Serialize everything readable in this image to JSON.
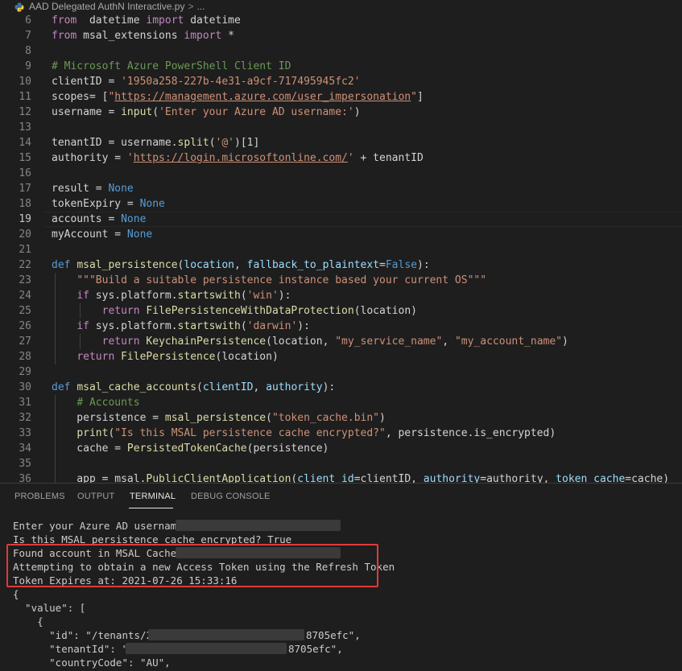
{
  "breadcrumb": {
    "file": "AAD Delegated AuthN Interactive.py",
    "separator": ">",
    "more": "..."
  },
  "editor": {
    "active_line": "19",
    "lines": [
      {
        "n": "6",
        "parts": [
          [
            "kw2",
            "from"
          ],
          [
            "",
            "  datetime "
          ],
          [
            "kw2",
            "import"
          ],
          [
            "",
            " datetime"
          ]
        ]
      },
      {
        "n": "7",
        "parts": [
          [
            "kw2",
            "from"
          ],
          [
            "",
            " msal_extensions "
          ],
          [
            "kw2",
            "import"
          ],
          [
            "",
            " *"
          ]
        ]
      },
      {
        "n": "8",
        "parts": []
      },
      {
        "n": "9",
        "parts": [
          [
            "cm",
            "# Microsoft Azure PowerShell Client ID"
          ]
        ]
      },
      {
        "n": "10",
        "parts": [
          [
            "",
            "clientID = "
          ],
          [
            "str",
            "'1950a258-227b-4e31-a9cf-717495945fc2'"
          ]
        ]
      },
      {
        "n": "11",
        "parts": [
          [
            "",
            "scopes= ["
          ],
          [
            "str",
            "\""
          ],
          [
            "str link",
            "https://management.azure.com/user_impersonation"
          ],
          [
            "str",
            "\""
          ],
          [
            "",
            "]"
          ]
        ]
      },
      {
        "n": "12",
        "parts": [
          [
            "",
            "username = "
          ],
          [
            "fn",
            "input"
          ],
          [
            "",
            "("
          ],
          [
            "str",
            "'Enter your Azure AD username:'"
          ],
          [
            "",
            ")"
          ]
        ]
      },
      {
        "n": "13",
        "parts": []
      },
      {
        "n": "14",
        "parts": [
          [
            "",
            "tenantID = username."
          ],
          [
            "fn",
            "split"
          ],
          [
            "",
            "("
          ],
          [
            "str",
            "'@'"
          ],
          [
            "",
            ")[1]"
          ]
        ]
      },
      {
        "n": "15",
        "parts": [
          [
            "",
            "authority = "
          ],
          [
            "str",
            "'"
          ],
          [
            "str link",
            "https://login.microsoftonline.com/"
          ],
          [
            "str",
            "'"
          ],
          [
            "",
            " + tenantID"
          ]
        ]
      },
      {
        "n": "16",
        "parts": []
      },
      {
        "n": "17",
        "parts": [
          [
            "",
            "result = "
          ],
          [
            "kw",
            "None"
          ]
        ]
      },
      {
        "n": "18",
        "parts": [
          [
            "",
            "tokenExpiry = "
          ],
          [
            "kw",
            "None"
          ]
        ]
      },
      {
        "n": "19",
        "parts": [
          [
            "",
            "accounts = "
          ],
          [
            "kw",
            "None"
          ]
        ]
      },
      {
        "n": "20",
        "parts": [
          [
            "",
            "myAccount = "
          ],
          [
            "kw",
            "None"
          ]
        ]
      },
      {
        "n": "21",
        "parts": []
      },
      {
        "n": "22",
        "parts": [
          [
            "kw",
            "def"
          ],
          [
            " ",
            ""
          ],
          [
            "fn",
            "msal_persistence"
          ],
          [
            "",
            "("
          ],
          [
            "pm",
            "location"
          ],
          [
            "",
            ", "
          ],
          [
            "pm",
            "fallback_to_plaintext"
          ],
          [
            "",
            "="
          ],
          [
            "kw",
            "False"
          ],
          [
            "",
            "):"
          ]
        ]
      },
      {
        "n": "23",
        "parts": [
          [
            "",
            "    "
          ],
          [
            "str",
            "\"\"\"Build a suitable persistence instance based your current OS\"\"\""
          ]
        ]
      },
      {
        "n": "24",
        "parts": [
          [
            "",
            "    "
          ],
          [
            "kw2",
            "if"
          ],
          [
            "",
            " sys.platform."
          ],
          [
            "fn",
            "startswith"
          ],
          [
            "",
            "("
          ],
          [
            "str",
            "'win'"
          ],
          [
            "",
            "):"
          ]
        ]
      },
      {
        "n": "25",
        "parts": [
          [
            "",
            "        "
          ],
          [
            "kw2",
            "return"
          ],
          [
            "",
            " "
          ],
          [
            "fn",
            "FilePersistenceWithDataProtection"
          ],
          [
            "",
            "(location)"
          ]
        ]
      },
      {
        "n": "26",
        "parts": [
          [
            "",
            "    "
          ],
          [
            "kw2",
            "if"
          ],
          [
            "",
            " sys.platform."
          ],
          [
            "fn",
            "startswith"
          ],
          [
            "",
            "("
          ],
          [
            "str",
            "'darwin'"
          ],
          [
            "",
            "):"
          ]
        ]
      },
      {
        "n": "27",
        "parts": [
          [
            "",
            "        "
          ],
          [
            "kw2",
            "return"
          ],
          [
            "",
            " "
          ],
          [
            "fn",
            "KeychainPersistence"
          ],
          [
            "",
            "(location, "
          ],
          [
            "str",
            "\"my_service_name\""
          ],
          [
            "",
            ", "
          ],
          [
            "str",
            "\"my_account_name\""
          ],
          [
            "",
            ")"
          ]
        ]
      },
      {
        "n": "28",
        "parts": [
          [
            "",
            "    "
          ],
          [
            "kw2",
            "return"
          ],
          [
            "",
            " "
          ],
          [
            "fn",
            "FilePersistence"
          ],
          [
            "",
            "(location)"
          ]
        ]
      },
      {
        "n": "29",
        "parts": []
      },
      {
        "n": "30",
        "parts": [
          [
            "kw",
            "def"
          ],
          [
            "",
            " "
          ],
          [
            "fn",
            "msal_cache_accounts"
          ],
          [
            "",
            "("
          ],
          [
            "pm",
            "clientID"
          ],
          [
            "",
            ", "
          ],
          [
            "pm",
            "authority"
          ],
          [
            "",
            "):"
          ]
        ]
      },
      {
        "n": "31",
        "parts": [
          [
            "",
            "    "
          ],
          [
            "cm",
            "# Accounts"
          ]
        ]
      },
      {
        "n": "32",
        "parts": [
          [
            "",
            "    persistence = "
          ],
          [
            "fn",
            "msal_persistence"
          ],
          [
            "",
            "("
          ],
          [
            "str",
            "\"token_cache.bin\""
          ],
          [
            "",
            ")"
          ]
        ]
      },
      {
        "n": "33",
        "parts": [
          [
            "",
            "    "
          ],
          [
            "fn",
            "print"
          ],
          [
            "",
            "("
          ],
          [
            "str",
            "\"Is this MSAL persistence cache encrypted?\""
          ],
          [
            "",
            ", persistence.is_encrypted)"
          ]
        ]
      },
      {
        "n": "34",
        "parts": [
          [
            "",
            "    cache = "
          ],
          [
            "fn",
            "PersistedTokenCache"
          ],
          [
            "",
            "(persistence)"
          ]
        ]
      },
      {
        "n": "35",
        "parts": []
      },
      {
        "n": "36",
        "parts": [
          [
            "",
            "    app = msal."
          ],
          [
            "fn",
            "PublicClientApplication"
          ],
          [
            "",
            "("
          ],
          [
            "pm",
            "client_id"
          ],
          [
            "",
            "=clientID, "
          ],
          [
            "pm",
            "authority"
          ],
          [
            "",
            "=authority, "
          ],
          [
            "pm",
            "token_cache"
          ],
          [
            "",
            "=cache)"
          ]
        ]
      }
    ]
  },
  "panel": {
    "tabs": [
      "PROBLEMS",
      "OUTPUT",
      "TERMINAL",
      "DEBUG CONSOLE"
    ],
    "active_tab": "TERMINAL",
    "terminal_lines": [
      "Enter your Azure AD username:",
      "Is this MSAL persistence cache encrypted? True",
      "Found account in MSAL Cache:",
      "Attempting to obtain a new Access Token using the Refresh Token",
      "Token Expires at: 2021-07-26 15:33:16",
      "{",
      "  \"value\": [",
      "    {",
      "      \"id\": \"/tenants/2",
      "      \"tenantId\": \"",
      "      \"countryCode\": \"AU\","
    ],
    "id_suffix": "8705efc\",",
    "tenant_suffix": "8705efc\","
  }
}
